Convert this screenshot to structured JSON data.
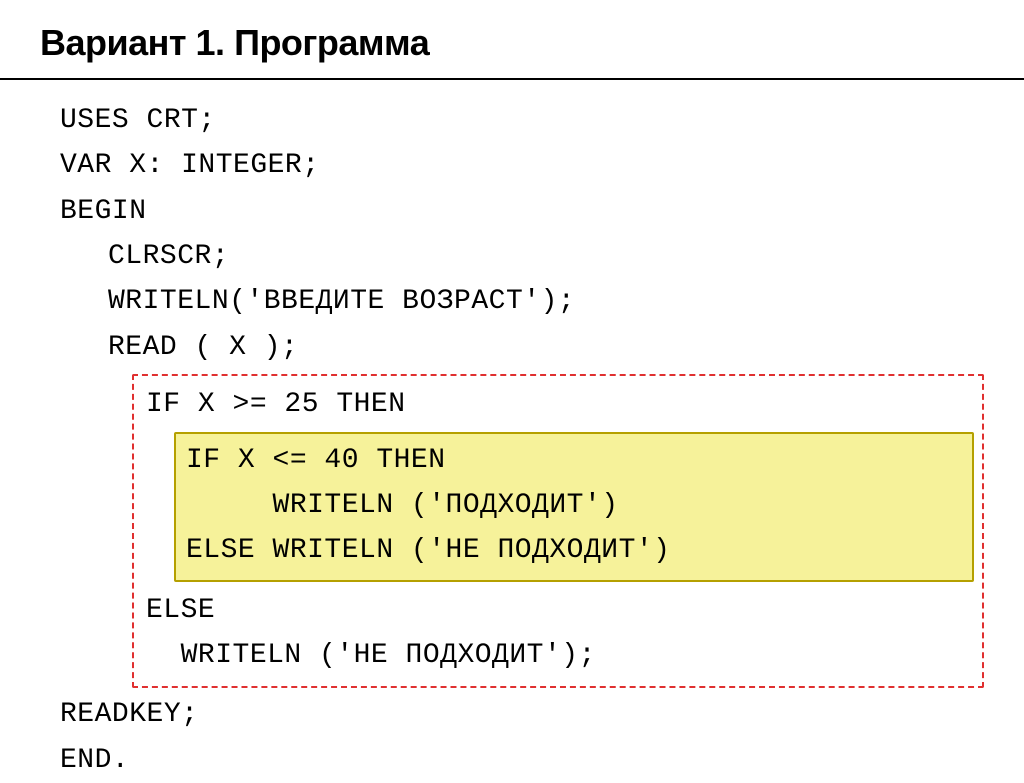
{
  "title": "Вариант 1. Программа",
  "code": {
    "l1": "USES CRT;",
    "l2": "VAR X: INTEGER;",
    "l3": "BEGIN",
    "l4": "CLRSCR;",
    "l5": "WRITELN('ВВЕДИТЕ ВОЗРАСТ');",
    "l6": "READ ( X );",
    "l7": "IF X >= 25 THEN",
    "l8": "IF X <= 40 THEN",
    "l9": "     WRITELN ('ПОДХОДИТ')",
    "l10": "ELSE WRITELN ('НЕ ПОДХОДИТ')",
    "l11": "ELSE",
    "l12": "  WRITELN ('НЕ ПОДХОДИТ');",
    "l13": "READKEY;",
    "l14": "END."
  }
}
